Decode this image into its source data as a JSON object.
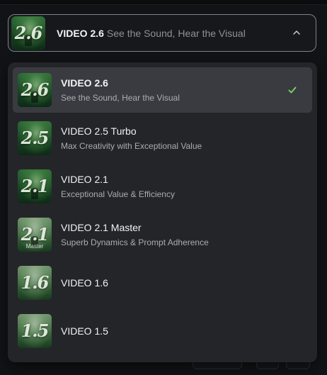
{
  "selector": {
    "current": {
      "title": "VIDEO 2.6",
      "tagline": "See the Sound, Hear the Visual",
      "thumb_text": "2.6"
    },
    "chevron_icon": "chevron-up-icon"
  },
  "menu": {
    "items": [
      {
        "name": "VIDEO 2.6",
        "desc": "See the Sound, Hear the Visual",
        "thumb_text": "2.6",
        "thumb_sub": "",
        "selected": true
      },
      {
        "name": "VIDEO 2.5 Turbo",
        "desc": "Max Creativity with Exceptional Value",
        "thumb_text": "2.5",
        "thumb_sub": ""
      },
      {
        "name": "VIDEO 2.1",
        "desc": "Exceptional Value & Efficiency",
        "thumb_text": "2.1",
        "thumb_sub": ""
      },
      {
        "name": "VIDEO 2.1 Master",
        "desc": "Superb Dynamics & Prompt Adherence",
        "thumb_text": "2.1",
        "thumb_sub": "Master"
      },
      {
        "name": "VIDEO 1.6",
        "desc": "",
        "thumb_text": "1.6",
        "thumb_sub": ""
      },
      {
        "name": "VIDEO 1.5",
        "desc": "",
        "thumb_text": "1.5",
        "thumb_sub": ""
      }
    ],
    "check_icon": "check-icon"
  },
  "colors": {
    "accent_check": "#7bd86a",
    "menu_bg": "#242529",
    "selected_bg": "#393b40"
  }
}
